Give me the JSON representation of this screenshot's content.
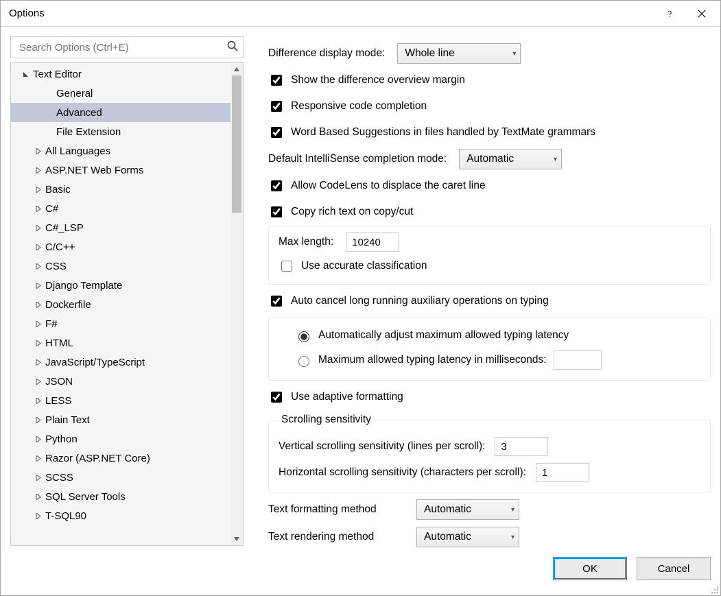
{
  "window": {
    "title": "Options"
  },
  "search": {
    "placeholder": "Search Options (Ctrl+E)"
  },
  "tree": {
    "root": "Text Editor",
    "children_noexpand": [
      "General",
      "Advanced",
      "File Extension"
    ],
    "selected": "Advanced",
    "children_expand": [
      "All Languages",
      "ASP.NET Web Forms",
      "Basic",
      "C#",
      "C#_LSP",
      "C/C++",
      "CSS",
      "Django Template",
      "Dockerfile",
      "F#",
      "HTML",
      "JavaScript/TypeScript",
      "JSON",
      "LESS",
      "Plain Text",
      "Python",
      "Razor (ASP.NET Core)",
      "SCSS",
      "SQL Server Tools",
      "T-SQL90"
    ]
  },
  "content": {
    "diff_mode_label": "Difference display mode:",
    "diff_mode_value": "Whole line",
    "chk_overview_margin": "Show the difference overview margin",
    "chk_responsive": "Responsive code completion",
    "chk_textmate": "Word Based Suggestions in files handled by TextMate grammars",
    "intellisense_label": "Default IntelliSense completion mode:",
    "intellisense_value": "Automatic",
    "chk_codelens": "Allow CodeLens to displace the caret line",
    "chk_copyrich": "Copy rich text on copy/cut",
    "maxlen_label": "Max length:",
    "maxlen_value": "10240",
    "chk_accurate": "Use accurate classification",
    "chk_autocancel": "Auto cancel long running auxiliary operations on typing",
    "rad_auto": "Automatically adjust maximum allowed typing latency",
    "rad_manual": "Maximum allowed typing latency in milliseconds:",
    "chk_adaptive": "Use adaptive formatting",
    "scroll_legend": "Scrolling sensitivity",
    "vscroll_label": "Vertical scrolling sensitivity (lines per scroll):",
    "vscroll_value": "3",
    "hscroll_label": "Horizontal scrolling sensitivity (characters per scroll):",
    "hscroll_value": "1",
    "fmt_method_label": "Text formatting method",
    "fmt_method_value": "Automatic",
    "render_method_label": "Text rendering method",
    "render_method_value": "Automatic"
  },
  "footer": {
    "ok": "OK",
    "cancel": "Cancel"
  }
}
